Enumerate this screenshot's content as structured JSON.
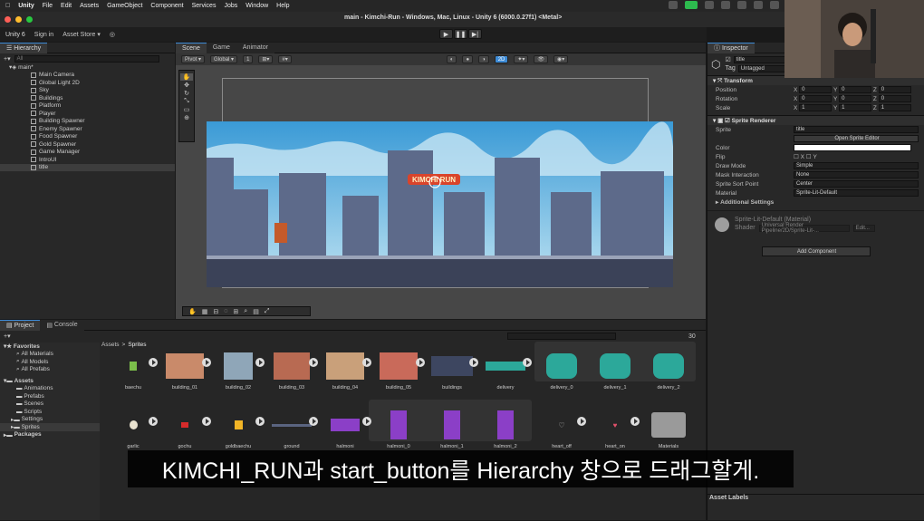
{
  "menubar": {
    "items": [
      "Unity",
      "File",
      "Edit",
      "Assets",
      "GameObject",
      "Component",
      "Services",
      "Jobs",
      "Window",
      "Help"
    ]
  },
  "window": {
    "title": "main - Kimchi-Run - Windows, Mac, Linux - Unity 6 (6000.0.27f1) <Metal>"
  },
  "toolbar": {
    "account": "Unity 6",
    "sign_in": "Sign in",
    "asset_store": "Asset Store ▾"
  },
  "hierarchy": {
    "tab": "Hierarchy",
    "search_placeholder": "All",
    "scene": "main*",
    "items": [
      "Main Camera",
      "Global Light 2D",
      "Sky",
      "Buildings",
      "Platform",
      "Player",
      "Building Spawner",
      "Enemy Spawner",
      "Food Spawner",
      "Gold Spawner",
      "Game Manager",
      "IntroUI",
      "title"
    ]
  },
  "scene_tabs": [
    "Scene",
    "Game",
    "Animator"
  ],
  "scene_toolbar": {
    "pivot": "Pivot ▾",
    "global": "Global ▾",
    "grid_step": "1",
    "mode_2d": "2D"
  },
  "game_title_sprite": "KIMCHI RUN",
  "inspector": {
    "tab": "Inspector",
    "object_name": "title",
    "tag_label": "Tag",
    "tag": "Untagged",
    "transform": {
      "header": "Transform",
      "position": {
        "label": "Position",
        "x": "0",
        "y": "0",
        "z": "0"
      },
      "rotation": {
        "label": "Rotation",
        "x": "0",
        "y": "0",
        "z": "0"
      },
      "scale": {
        "label": "Scale",
        "x": "1",
        "y": "1",
        "z": "1"
      }
    },
    "sprite_renderer": {
      "header": "Sprite Renderer",
      "sprite_label": "Sprite",
      "sprite": "title",
      "open_editor": "Open Sprite Editor",
      "color_label": "Color",
      "flip_label": "Flip",
      "flip_x": "X",
      "flip_y": "Y",
      "draw_mode_label": "Draw Mode",
      "draw_mode": "Simple",
      "mask_label": "Mask Interaction",
      "mask": "None",
      "sort_label": "Sprite Sort Point",
      "sort": "Center",
      "material_label": "Material",
      "material": "Sprite-Lit-Default",
      "additional": "Additional Settings"
    },
    "material_section": {
      "name": "Sprite-Lit-Default (Material)",
      "shader_label": "Shader",
      "shader": "Universal Render Pipeline/2D/Sprite-Lit-...",
      "edit": "Edit..."
    },
    "add_component": "Add Component",
    "asset_labels": "Asset Labels"
  },
  "project": {
    "tabs": [
      "Project",
      "Console"
    ],
    "favorites": "Favorites",
    "fav_items": [
      "All Materials",
      "All Models",
      "All Prefabs"
    ],
    "assets": "Assets",
    "asset_folders": [
      "Animations",
      "Prefabs",
      "Scenes",
      "Scripts",
      "Settings",
      "Sprites"
    ],
    "packages": "Packages",
    "breadcrumb": [
      "Assets",
      "Sprites"
    ],
    "count": "30",
    "row1": [
      "baechu",
      "building_01",
      "building_02",
      "building_03",
      "building_04",
      "building_05",
      "buildings",
      "delivery",
      "delivery_0",
      "delivery_1",
      "delivery_2"
    ],
    "row2": [
      "garlic",
      "gochu",
      "goldbaechu",
      "ground",
      "halmoni",
      "halmoni_0",
      "halmoni_1",
      "halmoni_2",
      "heart_off",
      "heart_on",
      "Materials"
    ]
  },
  "subtitle": "KIMCHI_RUN과 start_button를 Hierarchy 창으로 드래그할게.",
  "colors": {
    "accent": "#3d8bd6",
    "sky": "#6fb7e0",
    "building": "#5d6a8a",
    "halmoni": "#8b3fc7"
  }
}
